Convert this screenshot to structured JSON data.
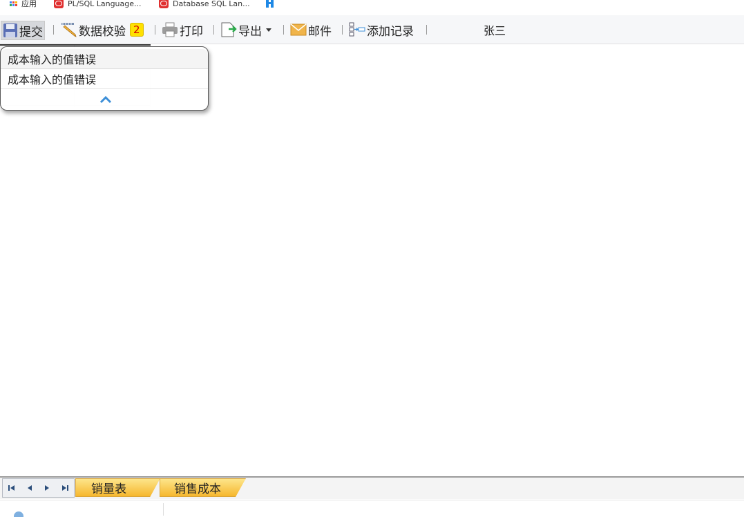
{
  "bookmarks": {
    "apps_label": "应用",
    "items": [
      {
        "label": "PL/SQL Language..."
      },
      {
        "label": "Database SQL Lan..."
      }
    ]
  },
  "toolbar": {
    "submit_label": "提交",
    "validate_label": "数据校验",
    "validate_count": "2",
    "print_label": "打印",
    "export_label": "导出",
    "mail_label": "邮件",
    "add_record_label": "添加记录",
    "user_name": "张三"
  },
  "error_popup": {
    "messages": [
      "成本输入的值错误",
      "成本输入的值错误"
    ]
  },
  "sheet_tabs": [
    {
      "label": "销量表"
    },
    {
      "label": "销售成本"
    }
  ],
  "colors": {
    "tab_top": "#fde58a",
    "tab_bottom": "#f6b72e",
    "badge_bg": "#ffe100",
    "badge_text": "#d00000",
    "accent_blue": "#3d8fd8"
  }
}
